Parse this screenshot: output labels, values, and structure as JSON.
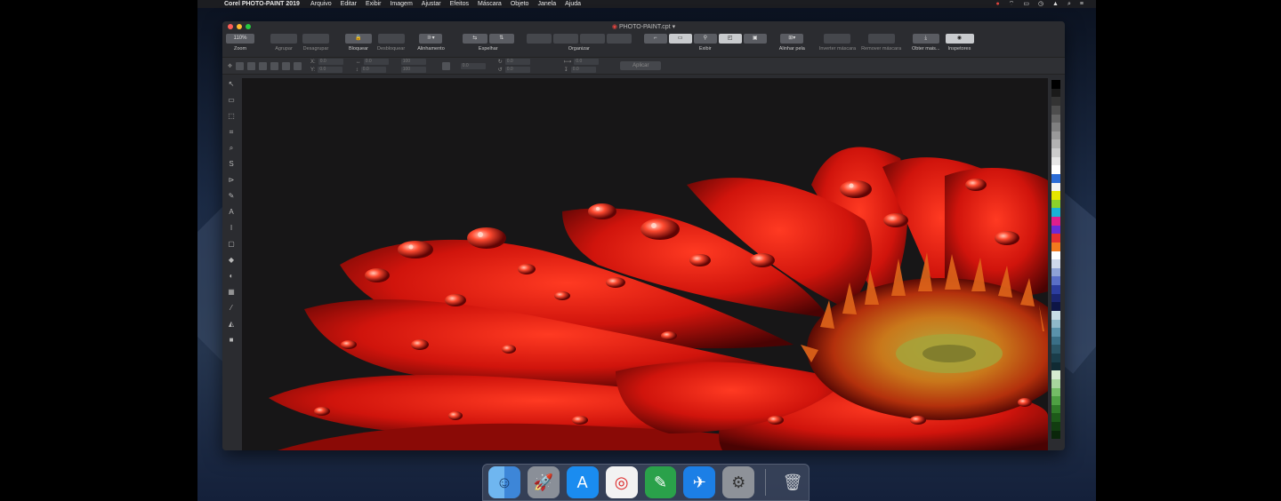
{
  "menubar": {
    "apple": "",
    "app_name": "Corel PHOTO-PAINT 2019",
    "items": [
      "Arquivo",
      "Editar",
      "Exibir",
      "Imagem",
      "Ajustar",
      "Efeitos",
      "Máscara",
      "Objeto",
      "Janela",
      "Ajuda"
    ],
    "status_icons": [
      "●",
      "⌔",
      "▭",
      "◷",
      "▲",
      "⌕",
      "≡"
    ]
  },
  "window": {
    "title": "PHOTO-PAINT.cpt",
    "title_caret": "▾"
  },
  "toolbar": {
    "zoom_value": "110%",
    "groups": [
      {
        "label": "Zoom"
      },
      {
        "label": "Agrupar"
      },
      {
        "label": "Desagrupar"
      },
      {
        "label": "Bloquear"
      },
      {
        "label": "Desbloquear"
      },
      {
        "label": "Alinhamento"
      },
      {
        "label": "Espelhar"
      },
      {
        "label": "Organizar"
      },
      {
        "label": "Exibir"
      },
      {
        "label": "Alinhar pela"
      },
      {
        "label": "Inverter máscara"
      },
      {
        "label": "Remover máscara"
      },
      {
        "label": "Obter mais..."
      },
      {
        "label": "Inspetores"
      }
    ]
  },
  "propbar": {
    "x_label": "X:",
    "y_label": "Y:",
    "x_value": "0.0",
    "y_value": "0.0",
    "w_value": "0.0",
    "h_value": "0.0",
    "sx_value": "100",
    "sy_value": "100",
    "rot_value": "0.0",
    "c1": "0.0",
    "c2": "0.0",
    "c3": "0.0",
    "c4": "0.0",
    "apply_label": "Aplicar"
  },
  "tools": [
    "↖",
    "▭",
    "⬚",
    "⌗",
    "⌕",
    "S",
    "⊳",
    "✎",
    "A",
    "ǀ",
    "▢",
    "◆",
    "◐",
    "▦",
    "⁄",
    "◭",
    "■"
  ],
  "palette": [
    "#000000",
    "#1a1a1a",
    "#333333",
    "#4d4d4d",
    "#666666",
    "#808080",
    "#999999",
    "#b3b3b3",
    "#cccccc",
    "#e6e6e6",
    "#ffffff",
    "#2b6cd6",
    "#f2f2f2",
    "#e6e600",
    "#8bd12a",
    "#19b3d6",
    "#e01e8c",
    "#6a2bd6",
    "#e62e2e",
    "#f27a1e",
    "#ffffff",
    "#cfd8ea",
    "#8fa3d6",
    "#5a6fc7",
    "#2c3d9e",
    "#1a2570",
    "#0d1545",
    "#c8dde6",
    "#8fb8c9",
    "#5a92ab",
    "#3a6f87",
    "#2a5566",
    "#1a3d4a",
    "#102a33",
    "#d6ead0",
    "#a8d69e",
    "#74bd66",
    "#4ea043",
    "#2f7a28",
    "#1d5a19",
    "#123d10",
    "#0a260a"
  ],
  "dock": [
    {
      "name": "Finder",
      "glyph": "☺"
    },
    {
      "name": "Launchpad",
      "glyph": "🚀"
    },
    {
      "name": "App Store",
      "glyph": "A"
    },
    {
      "name": "CorelDRAW",
      "glyph": "◎"
    },
    {
      "name": "Corel PHOTO-PAINT",
      "glyph": "✎"
    },
    {
      "name": "Safari",
      "glyph": "✈"
    },
    {
      "name": "System Preferences",
      "glyph": "⚙"
    },
    {
      "name": "Trash",
      "glyph": "🗑"
    }
  ]
}
